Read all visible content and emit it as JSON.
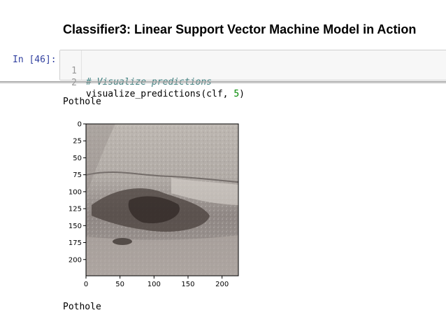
{
  "notebook": {
    "heading": "Classifier3: Linear Support Vector Machine Model in Action",
    "cell": {
      "prompt": "In [46]:",
      "lines": [
        {
          "number": "1",
          "text": "# Visualize predictions"
        },
        {
          "number": "2",
          "text_parts": [
            "visualize_predictions(clf, ",
            "5",
            ")"
          ]
        }
      ]
    },
    "outputs": [
      {
        "label": "Pothole",
        "image": {
          "description_icon": "pothole-image",
          "x_ticks": [
            "0",
            "50",
            "100",
            "150",
            "200"
          ],
          "y_ticks": [
            "0",
            "25",
            "50",
            "75",
            "100",
            "125",
            "150",
            "175",
            "200"
          ],
          "x_range": [
            0,
            224
          ],
          "y_range": [
            0,
            224
          ]
        }
      },
      {
        "label": "Pothole"
      }
    ]
  }
}
